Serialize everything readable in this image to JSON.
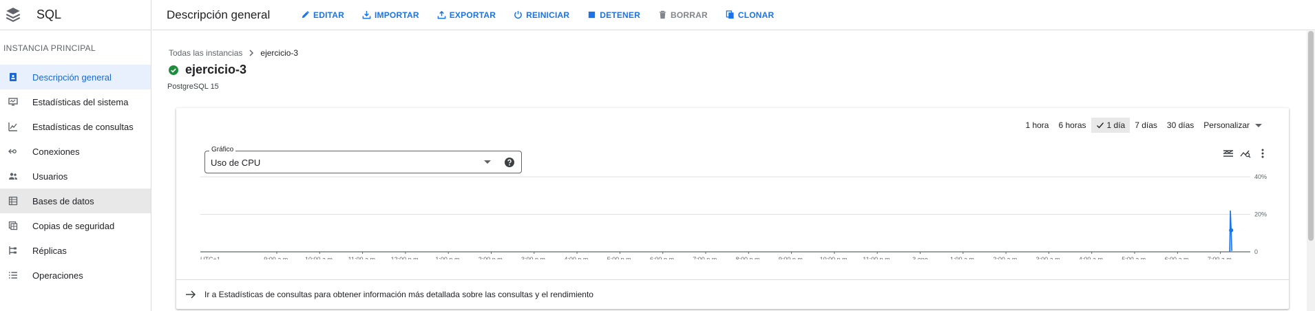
{
  "product": {
    "name": "SQL",
    "icon": "sql-stack-icon"
  },
  "sidebar": {
    "section_title": "INSTANCIA PRINCIPAL",
    "items": [
      {
        "label": "Descripción general",
        "icon": "overview-icon",
        "active": true
      },
      {
        "label": "Estadísticas del sistema",
        "icon": "system-insights-icon"
      },
      {
        "label": "Estadísticas de consultas",
        "icon": "query-insights-icon"
      },
      {
        "label": "Conexiones",
        "icon": "connections-icon"
      },
      {
        "label": "Usuarios",
        "icon": "users-icon"
      },
      {
        "label": "Bases de datos",
        "icon": "databases-icon",
        "hovered": true
      },
      {
        "label": "Copias de seguridad",
        "icon": "backups-icon"
      },
      {
        "label": "Réplicas",
        "icon": "replicas-icon"
      },
      {
        "label": "Operaciones",
        "icon": "operations-icon"
      }
    ]
  },
  "topbar": {
    "title": "Descripción general",
    "actions": [
      {
        "label": "EDITAR",
        "icon": "edit-icon"
      },
      {
        "label": "IMPORTAR",
        "icon": "import-icon"
      },
      {
        "label": "EXPORTAR",
        "icon": "export-icon"
      },
      {
        "label": "REINICIAR",
        "icon": "restart-icon"
      },
      {
        "label": "DETENER",
        "icon": "stop-icon"
      },
      {
        "label": "BORRAR",
        "icon": "delete-icon",
        "disabled": true
      },
      {
        "label": "CLONAR",
        "icon": "clone-icon"
      }
    ]
  },
  "breadcrumb": {
    "parent": "Todas las instancias",
    "current": "ejercicio-3"
  },
  "instance": {
    "name": "ejercicio-3",
    "version": "PostgreSQL 15",
    "status": "running"
  },
  "time_ranges": {
    "options": [
      "1 hora",
      "6 horas",
      "1 día",
      "7 días",
      "30 días"
    ],
    "selected": "1 día",
    "custom_label": "Personalizar"
  },
  "chart_selector": {
    "legend": "Gráfico",
    "value": "Uso de CPU"
  },
  "colors": {
    "accent": "#1a73e8",
    "success": "#1e8e3e",
    "series": "#1a73e8"
  },
  "chart_data": {
    "type": "line",
    "title": "",
    "xlabel": "",
    "ylabel": "",
    "timezone_label": "UTC+1",
    "x_ticks": [
      "9:00 a.m.",
      "10:00 a.m.",
      "11:00 a.m.",
      "12:00 p.m.",
      "1:00 p.m.",
      "2:00 p.m.",
      "3:00 p.m.",
      "4:00 p.m.",
      "5:00 p.m.",
      "6:00 p.m.",
      "7:00 p.m.",
      "8:00 p.m.",
      "9:00 p.m.",
      "10:00 p.m.",
      "11:00 p.m.",
      "3 ene",
      "1:00 a.m.",
      "2:00 a.m.",
      "3:00 a.m.",
      "4:00 a.m.",
      "5:00 a.m.",
      "6:00 a.m.",
      "7:00 a.m."
    ],
    "y_ticks": [
      "0",
      "20%",
      "40%"
    ],
    "ylim": [
      0,
      40
    ],
    "series": [
      {
        "points": [
          {
            "x": "7:13 a.m.",
            "y": 0
          },
          {
            "x": "7:14 a.m.",
            "y": 22
          },
          {
            "x": "7:15 a.m.",
            "y": 11.5
          },
          {
            "x": "7:16 a.m.",
            "y": 0.5
          }
        ]
      }
    ],
    "grid": true
  },
  "footer": {
    "link_text": "Ir a Estadísticas de consultas para obtener información más detallada sobre las consultas y el rendimiento"
  }
}
